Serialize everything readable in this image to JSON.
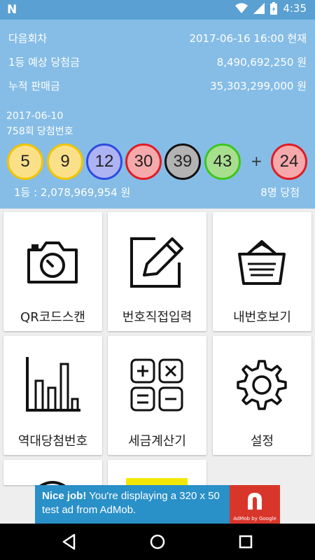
{
  "status_bar": {
    "time": "4:35"
  },
  "header": {
    "next_round_label": "다음회차",
    "next_round_value": "2017-06-16 16:00 현재",
    "expected_prize_label": "1등 예상 당첨금",
    "expected_prize_value": "8,490,692,250 원",
    "total_sales_label": "누적 판매금",
    "total_sales_value": "35,303,299,000 원",
    "draw_date": "2017-06-10",
    "draw_title": "758회 당첨번호",
    "balls": [
      "5",
      "9",
      "12",
      "30",
      "39",
      "43"
    ],
    "bonus_ball": "24",
    "plus": "+",
    "first_prize": "1등 : 2,078,969,954 원",
    "winners": "8명 당첨"
  },
  "menu": {
    "qr_scan": "QR코드스캔",
    "manual_input": "번호직접입력",
    "my_numbers": "내번호보기",
    "history": "역대당첨번호",
    "tax_calc": "세금계산기",
    "settings": "설정"
  },
  "ad": {
    "bold": "Nice job!",
    "text": " You're displaying a 320 x 50 test ad from AdMob.",
    "byline": "AdMob by Google"
  },
  "colors": {
    "status_bar": "#5aa0d2",
    "header_bg": "#86bde6",
    "ad_bg": "#2a90c8",
    "ad_logo": "#d9362b"
  }
}
